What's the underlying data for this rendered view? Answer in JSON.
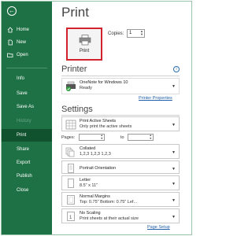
{
  "sidebar": {
    "items": [
      {
        "label": "Home"
      },
      {
        "label": "New"
      },
      {
        "label": "Open"
      },
      {
        "label": "Info"
      },
      {
        "label": "Save"
      },
      {
        "label": "Save As"
      },
      {
        "label": "History"
      },
      {
        "label": "Print"
      },
      {
        "label": "Share"
      },
      {
        "label": "Export"
      },
      {
        "label": "Publish"
      },
      {
        "label": "Close"
      }
    ]
  },
  "main": {
    "title": "Print",
    "print_button_label": "Print",
    "copies_label": "Copies:",
    "copies_value": "1",
    "printer_heading": "Printer",
    "printer_name": "OneNote for Windows 10",
    "printer_status": "Ready",
    "printer_properties_link": "Printer Properties",
    "settings_heading": "Settings",
    "settings": {
      "scope_line1": "Print Active Sheets",
      "scope_line2": "Only print the active sheets",
      "pages_label": "Pages:",
      "to_label": "to",
      "collation_line1": "Collated",
      "collation_line2": "1,2,3    1,2,3    1,2,3",
      "orientation": "Portrait Orientation",
      "paper_line1": "Letter",
      "paper_line2": "8.5\" x 11\"",
      "margins_line1": "Normal Margins",
      "margins_line2": "Top: 0.75\" Bottom: 0.75\" Lef...",
      "scaling_line1": "No Scaling",
      "scaling_line2": "Print sheets at their actual size"
    },
    "page_setup_link": "Page Setup"
  },
  "colors": {
    "sidebar_bg": "#1e7145",
    "sidebar_selected": "#10522e",
    "print_button_border": "#d0232b",
    "link": "#1f5ea8"
  }
}
